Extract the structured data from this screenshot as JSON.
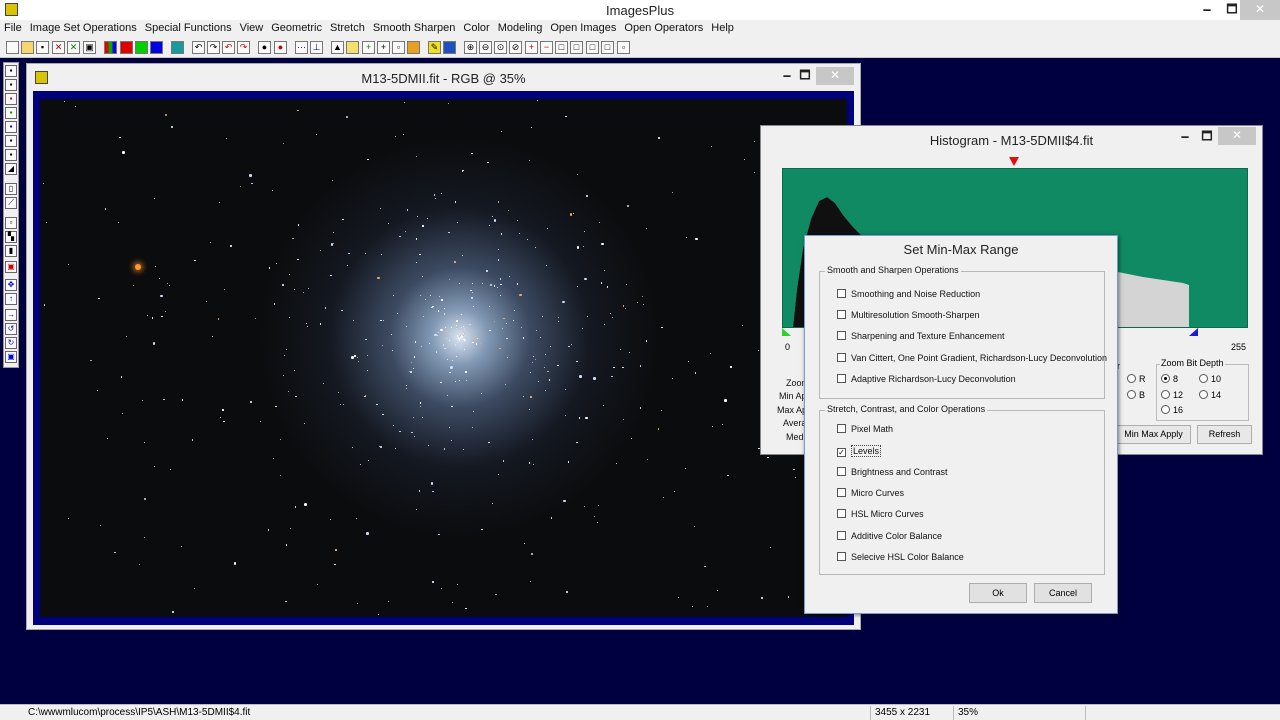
{
  "app": {
    "title": "ImagesPlus"
  },
  "window_controls": {
    "minimize": "🗕",
    "maximize": "🗖",
    "close": "✕"
  },
  "menu": [
    "File",
    "Image Set Operations",
    "Special Functions",
    "View",
    "Geometric",
    "Stretch",
    "Smooth Sharpen",
    "Color",
    "Modeling",
    "Open Images",
    "Open Operators",
    "Help"
  ],
  "image_window": {
    "title": "M13-5DMII.fit - RGB @ 35%"
  },
  "histogram_window": {
    "title": "Histogram - M13-5DMII$4.fit",
    "x_min": "0",
    "x_max": "255",
    "labels": [
      "Zoom",
      "Min Ap",
      "Max Ap",
      "Avera",
      "Med"
    ],
    "partial_label": "r",
    "rgb_radios": [
      "R",
      "B"
    ],
    "zoom_group": {
      "title": "Zoom Bit Depth",
      "options": [
        "8",
        "10",
        "12",
        "14",
        "16"
      ],
      "selected": "8"
    },
    "buttons": {
      "min_max_apply": "Min Max Apply",
      "refresh": "Refresh"
    }
  },
  "dialog": {
    "title": "Set Min-Max Range",
    "groups": [
      {
        "title": "Smooth and Sharpen Operations",
        "items": [
          {
            "label": "Smoothing and Noise Reduction",
            "checked": false
          },
          {
            "label": "Multiresolution Smooth-Sharpen",
            "checked": false
          },
          {
            "label": "Sharpening and Texture Enhancement",
            "checked": false
          },
          {
            "label": "Van Cittert, One Point Gradient,  Richardson-Lucy Deconvolution",
            "checked": false
          },
          {
            "label": "Adaptive Richardson-Lucy Deconvolution",
            "checked": false
          }
        ]
      },
      {
        "title": "Stretch, Contrast, and Color Operations",
        "items": [
          {
            "label": "Pixel Math",
            "checked": false
          },
          {
            "label": "Levels",
            "checked": true
          },
          {
            "label": "Brightness and Contrast",
            "checked": false
          },
          {
            "label": "Micro Curves",
            "checked": false
          },
          {
            "label": "HSL Micro Curves",
            "checked": false
          },
          {
            "label": "Additive Color Balance",
            "checked": false
          },
          {
            "label": "Selecive HSL Color Balance",
            "checked": false
          }
        ]
      }
    ],
    "buttons": {
      "ok": "Ok",
      "cancel": "Cancel"
    }
  },
  "status": {
    "path": "C:\\wwwmlucom\\process\\IP5\\ASH\\M13-5DMII$4.fit",
    "dimensions": "3455 x 2231",
    "zoom": "35%"
  },
  "colors": {
    "workspace": "#000040",
    "image_frame": "#00007a",
    "histogram_bg": "#0f8a63",
    "marker_top": "#e01010",
    "marker_left": "#2bd52b",
    "marker_right": "#1a1ad8"
  }
}
